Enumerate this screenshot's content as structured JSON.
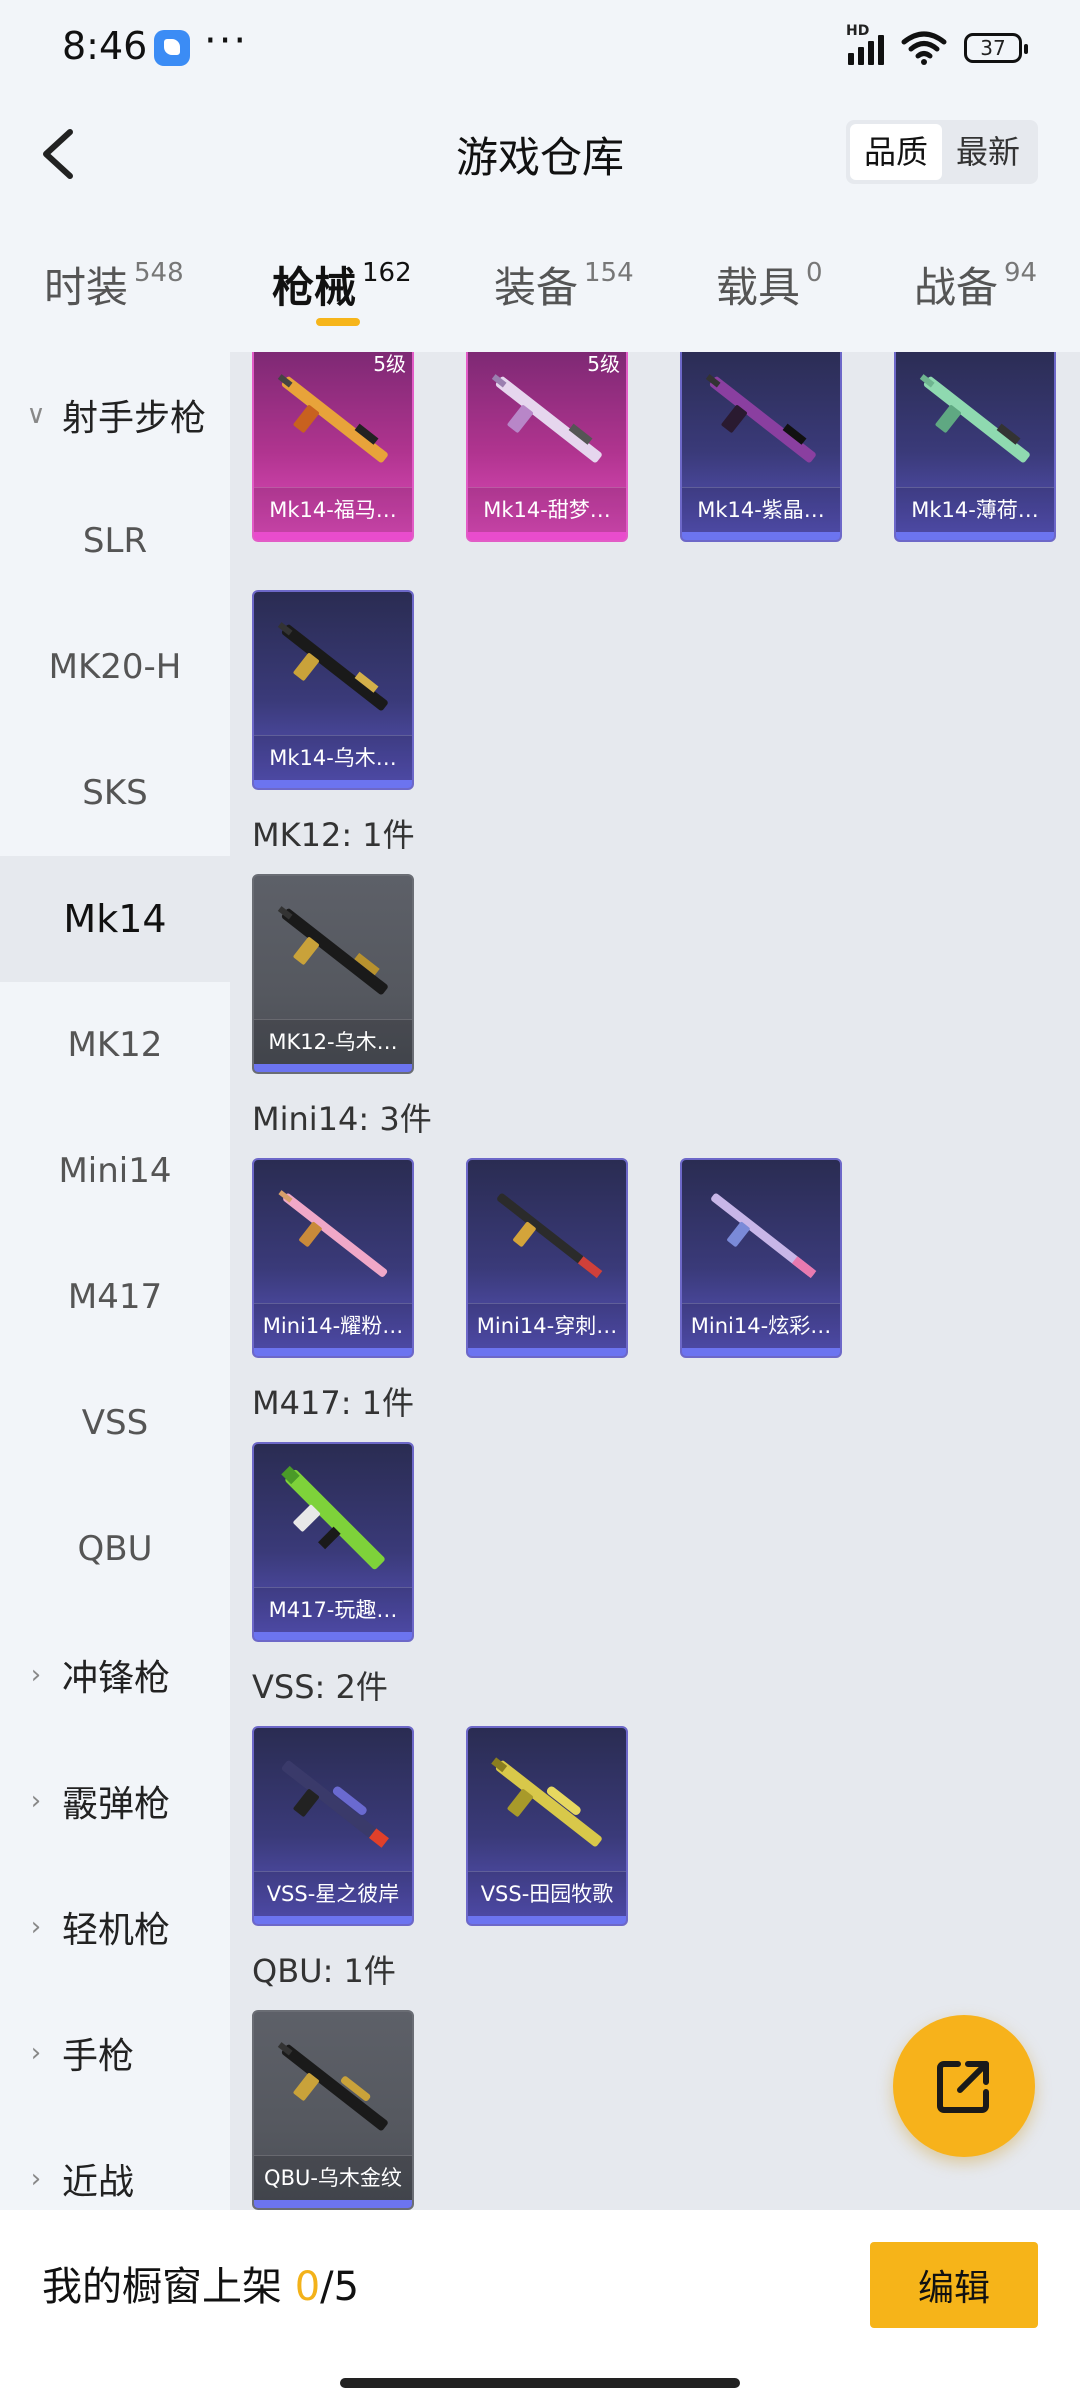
{
  "status_bar": {
    "time": "8:46",
    "battery": "37",
    "network": "HD"
  },
  "header": {
    "title": "游戏仓库",
    "sort_options": [
      "品质",
      "最新"
    ],
    "sort_active": "品质"
  },
  "category_tabs": [
    {
      "label": "时装",
      "count": "548"
    },
    {
      "label": "枪械",
      "count": "162",
      "active": true
    },
    {
      "label": "装备",
      "count": "154"
    },
    {
      "label": "载具",
      "count": "0"
    },
    {
      "label": "战备",
      "count": "94"
    }
  ],
  "sidebar": {
    "group_open": "射手步枪",
    "subitems": [
      "SLR",
      "MK20-H",
      "SKS",
      "Mk14",
      "MK12",
      "Mini14",
      "M417",
      "VSS",
      "QBU"
    ],
    "active_subitem": "Mk14",
    "groups_collapsed": [
      "冲锋枪",
      "霰弹枪",
      "轻机枪",
      "手枪",
      "近战"
    ]
  },
  "content": {
    "top_cards": [
      {
        "name": "Mk14-福马…",
        "level": "5级",
        "quality": "pink"
      },
      {
        "name": "Mk14-甜梦…",
        "level": "5级",
        "quality": "pink"
      },
      {
        "name": "Mk14-紫晶…",
        "quality": "purple"
      },
      {
        "name": "Mk14-薄荷…",
        "quality": "purple"
      },
      {
        "name": "Mk14-乌木…",
        "quality": "purple"
      }
    ],
    "sections": [
      {
        "label": "MK12: 1件",
        "items": [
          {
            "name": "MK12-乌木…",
            "quality": "gray"
          }
        ]
      },
      {
        "label": "Mini14: 3件",
        "items": [
          {
            "name": "Mini14-耀粉…",
            "quality": "purple"
          },
          {
            "name": "Mini14-穿刺…",
            "quality": "purple"
          },
          {
            "name": "Mini14-炫彩…",
            "quality": "purple"
          }
        ]
      },
      {
        "label": "M417: 1件",
        "items": [
          {
            "name": "M417-玩趣…",
            "quality": "purple"
          }
        ]
      },
      {
        "label": "VSS: 2件",
        "items": [
          {
            "name": "VSS-星之彼岸",
            "quality": "purple"
          },
          {
            "name": "VSS-田园牧歌",
            "quality": "purple"
          }
        ]
      },
      {
        "label": "QBU: 1件",
        "items": [
          {
            "name": "QBU-乌木金纹",
            "quality": "gray"
          }
        ]
      }
    ]
  },
  "bottom_bar": {
    "label": "我的橱窗上架 ",
    "used": "0",
    "separator": "/",
    "total": "5",
    "edit_label": "编辑"
  },
  "colors": {
    "accent": "#f6b419",
    "pink_quality": "#e94ccd",
    "purple_quality": "#6c74f0"
  }
}
